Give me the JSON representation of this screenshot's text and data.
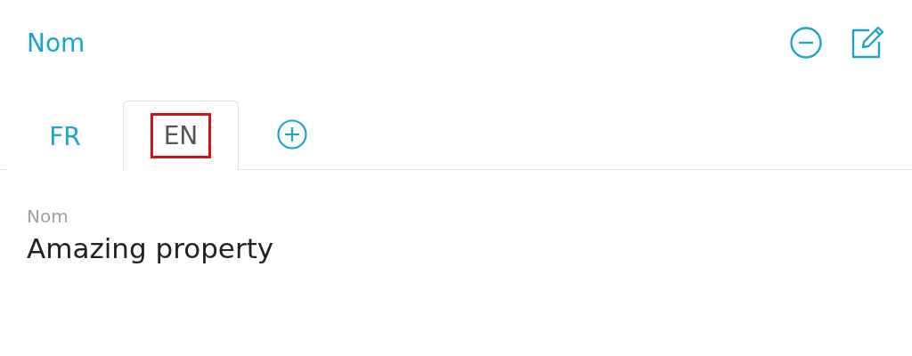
{
  "header": {
    "title": "Nom"
  },
  "tabs": [
    {
      "label": "FR",
      "selected": false,
      "highlighted": false
    },
    {
      "label": "EN",
      "selected": true,
      "highlighted": true
    }
  ],
  "field": {
    "label": "Nom",
    "value": "Amazing property"
  }
}
